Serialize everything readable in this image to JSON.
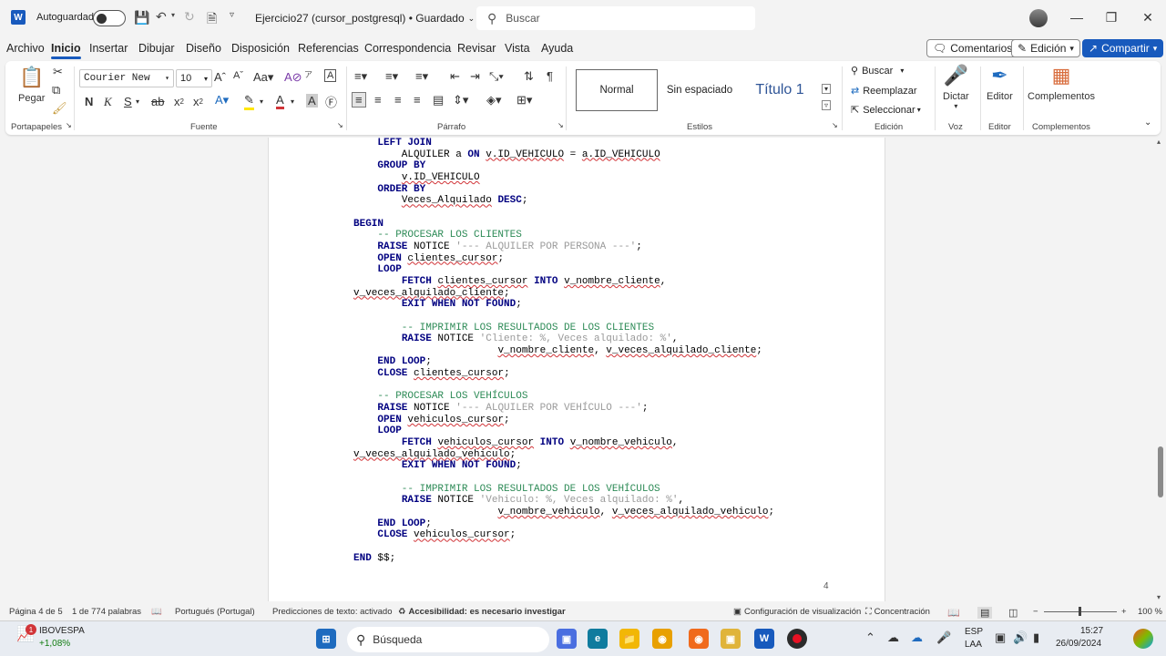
{
  "titlebar": {
    "autosave_label": "Autoguardado",
    "document_title": "Ejercicio27 (cursor_postgresql) • Guardado",
    "search_placeholder": "Buscar"
  },
  "menu": {
    "tabs": [
      "Archivo",
      "Inicio",
      "Insertar",
      "Dibujar",
      "Diseño",
      "Disposición",
      "Referencias",
      "Correspondencia",
      "Revisar",
      "Vista",
      "Ayuda"
    ],
    "active_tab": "Inicio",
    "comments_label": "Comentarios",
    "edit_mode_label": "Edición",
    "share_label": "Compartir"
  },
  "ribbon": {
    "paste_label": "Pegar",
    "font_name": "Courier New",
    "font_size": "10",
    "styles": [
      "Normal",
      "Sin espaciado",
      "Título 1"
    ],
    "find_label": "Buscar",
    "replace_label": "Reemplazar",
    "select_label": "Seleccionar",
    "dictate_label": "Dictar",
    "editor_label": "Editor",
    "addins_label": "Complementos",
    "groups": {
      "clipboard": "Portapapeles",
      "font": "Fuente",
      "paragraph": "Párrafo",
      "styles": "Estilos",
      "editing": "Edición",
      "voice": "Voz",
      "editor": "Editor",
      "addins": "Complementos"
    }
  },
  "document": {
    "page_number": "4",
    "code_lines": [
      "    LEFT JOIN",
      "        ALQUILER a ON v.ID_VEHICULO = a.ID_VEHICULO",
      "    GROUP BY",
      "        v.ID_VEHICULO",
      "    ORDER BY",
      "        Veces_Alquilado DESC;",
      "",
      "BEGIN",
      "    -- PROCESAR LOS CLIENTES",
      "    RAISE NOTICE '--- ALQUILER POR PERSONA ---';",
      "    OPEN clientes_cursor;",
      "    LOOP",
      "        FETCH clientes_cursor INTO v_nombre_cliente,",
      "v_veces_alquilado_cliente;",
      "        EXIT WHEN NOT FOUND;",
      "",
      "        -- IMPRIMIR LOS RESULTADOS DE LOS CLIENTES",
      "        RAISE NOTICE 'Cliente: %, Veces alquilado: %',",
      "                        v_nombre_cliente, v_veces_alquilado_cliente;",
      "    END LOOP;",
      "    CLOSE clientes_cursor;",
      "",
      "    -- PROCESAR LOS VEHÍCULOS",
      "    RAISE NOTICE '--- ALQUILER POR VEHÍCULO ---';",
      "    OPEN vehiculos_cursor;",
      "    LOOP",
      "        FETCH vehiculos_cursor INTO v_nombre_vehiculo,",
      "v_veces_alquilado_vehiculo;",
      "        EXIT WHEN NOT FOUND;",
      "",
      "        -- IMPRIMIR LOS RESULTADOS DE LOS VEHÍCULOS",
      "        RAISE NOTICE 'Vehiculo: %, Veces alquilado: %',",
      "                        v_nombre_vehiculo, v_veces_alquilado_vehiculo;",
      "    END LOOP;",
      "    CLOSE vehiculos_cursor;",
      "",
      "END $$;"
    ]
  },
  "statusbar": {
    "page": "Página 4 de 5",
    "words": "1 de 774 palabras",
    "language": "Portugués (Portugal)",
    "predictions": "Predicciones de texto: activado",
    "accessibility": "Accesibilidad: es necesario investigar",
    "display_settings": "Configuración de visualización",
    "focus": "Concentración",
    "zoom": "100 %"
  },
  "taskbar": {
    "ticker_name": "IBOVESPA",
    "ticker_change": "+1,08%",
    "ticker_badge": "1",
    "search_label": "Búsqueda",
    "lang_1": "ESP",
    "lang_2": "LAA",
    "time": "15:27",
    "date": "26/09/2024"
  },
  "colors": {
    "accent": "#185abd",
    "keyword": "#000080",
    "comment": "#2e8b57",
    "string": "#9a9a9a"
  }
}
